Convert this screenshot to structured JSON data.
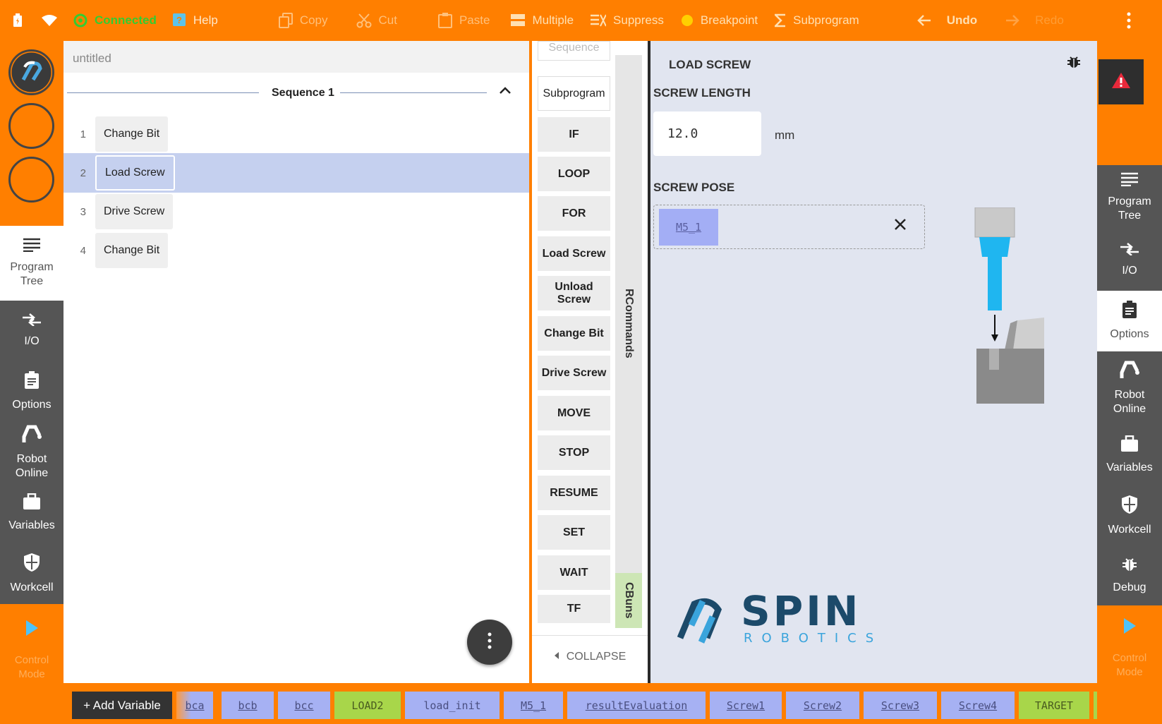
{
  "topbar": {
    "status": "Connected",
    "help": "Help",
    "copy": "Copy",
    "cut": "Cut",
    "paste": "Paste",
    "multiple": "Multiple",
    "suppress": "Suppress",
    "breakpoint": "Breakpoint",
    "subprogram": "Subprogram",
    "undo": "Undo",
    "redo": "Redo"
  },
  "left_nav": {
    "program_tree": "Program Tree",
    "io": "I/O",
    "options": "Options",
    "robot_online": "Robot Online",
    "variables": "Variables",
    "workcell": "Workcell",
    "control_mode": "Control Mode"
  },
  "right_nav": {
    "program_tree": "Program Tree",
    "io": "I/O",
    "options": "Options",
    "robot_online": "Robot Online",
    "variables": "Variables",
    "workcell": "Workcell",
    "debug": "Debug",
    "control_mode": "Control Mode"
  },
  "program": {
    "title": "untitled",
    "sequence": "Sequence 1",
    "steps": [
      {
        "num": "1",
        "label": "Change Bit"
      },
      {
        "num": "2",
        "label": "Load Screw"
      },
      {
        "num": "3",
        "label": "Drive Screw"
      },
      {
        "num": "4",
        "label": "Change Bit"
      }
    ]
  },
  "palette": {
    "commands": [
      "Sequence",
      "Subprogram",
      "IF",
      "LOOP",
      "FOR",
      "Load Screw",
      "Unload Screw",
      "Change Bit",
      "Drive Screw",
      "MOVE",
      "STOP",
      "RESUME",
      "SET",
      "WAIT",
      "TF"
    ],
    "tab_rcommands": "RCommands",
    "tab_cbuns": "CBuns",
    "collapse": "COLLAPSE"
  },
  "details": {
    "title": "LOAD SCREW",
    "screw_length_label": "SCREW LENGTH",
    "screw_length_value": "12.0",
    "unit": "mm",
    "screw_pose_label": "SCREW POSE",
    "screw_pose_value": "M5_1",
    "brand_main": "SPIN",
    "brand_sub": "ROBOTICS"
  },
  "variables": {
    "add": "+ Add Variable",
    "items": [
      {
        "label": "bca",
        "kind": "blue"
      },
      {
        "label": "bcb",
        "kind": "blue"
      },
      {
        "label": "bcc",
        "kind": "blue"
      },
      {
        "label": "LOAD2",
        "kind": "green"
      },
      {
        "label": "load_init",
        "kind": "blue-plain"
      },
      {
        "label": "M5_1",
        "kind": "blue"
      },
      {
        "label": "resultEvaluation",
        "kind": "blue"
      },
      {
        "label": "Screw1",
        "kind": "blue"
      },
      {
        "label": "Screw2",
        "kind": "blue"
      },
      {
        "label": "Screw3",
        "kind": "blue"
      },
      {
        "label": "Screw4",
        "kind": "blue"
      },
      {
        "label": "TARGET",
        "kind": "green"
      }
    ]
  },
  "colors": {
    "accent": "#ff7f00",
    "selected_row": "#c5d0ef",
    "variable_chip": "#a6b1f3",
    "variable_chip_green": "#a8d64a",
    "connected": "#32cd32"
  }
}
